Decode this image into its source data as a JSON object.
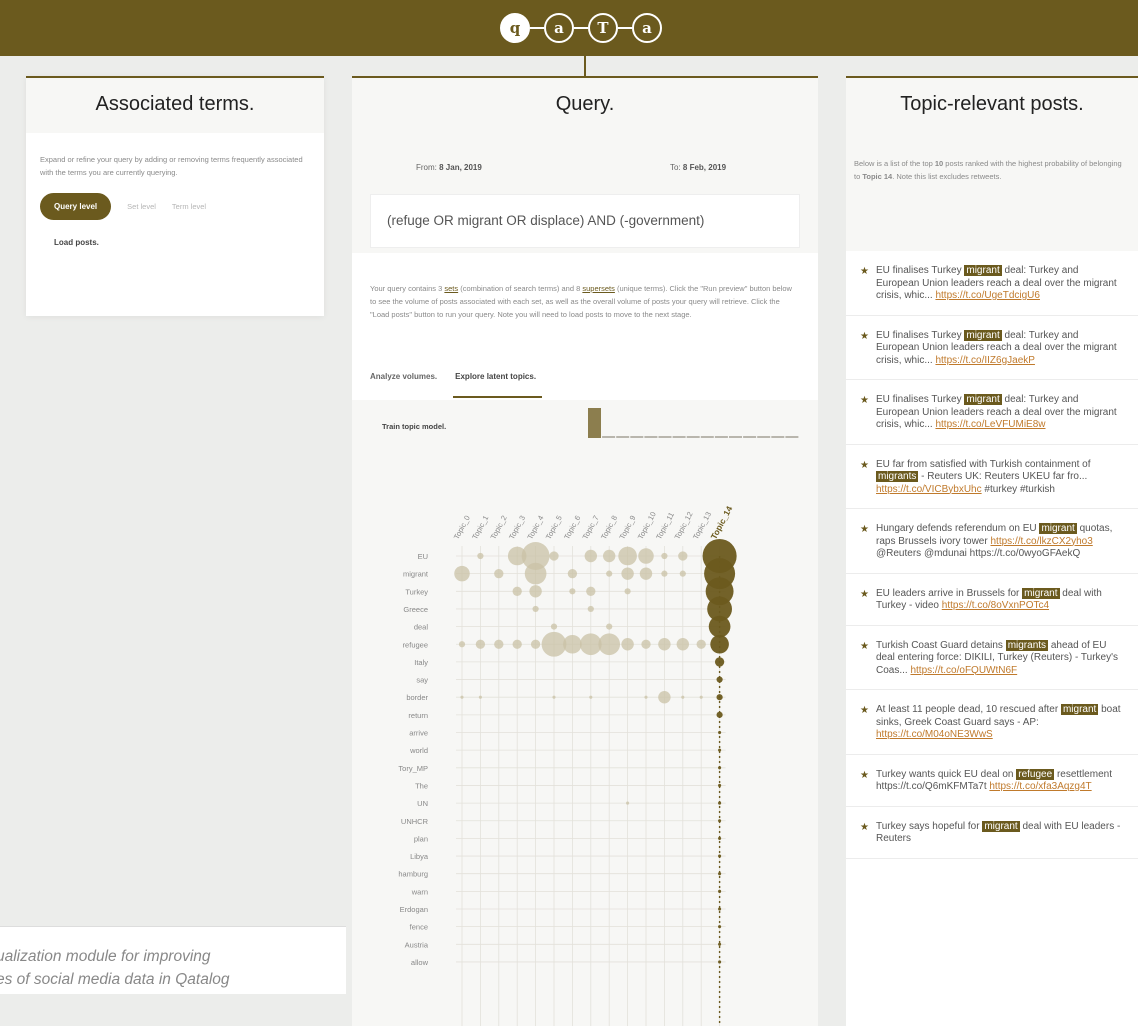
{
  "header": {
    "logo_letters": [
      "q",
      "a",
      "T",
      "a"
    ],
    "brand_color": "#6b5a1e"
  },
  "left_panel": {
    "title": "Associated terms.",
    "description": "Expand or refine your query by adding or removing terms frequently associated with the terms you are currently querying.",
    "mode_active": "Query level",
    "mode_set": "Set level",
    "mode_term": "Term level",
    "load_link": "Load posts."
  },
  "middle_panel": {
    "title": "Query.",
    "from_label": "From:",
    "from_value": "8 Jan, 2019",
    "to_label": "To:",
    "to_value": "8 Feb, 2019",
    "query": "(refuge OR migrant OR displace) AND (-government)",
    "note_a": "Your query contains ",
    "note_sets_count": "3",
    "note_sets_word": "sets",
    "note_b": " (combination of search terms) and ",
    "note_super_count": "8",
    "note_super_word": "supersets",
    "note_c": " (unique terms). Click the \"Run preview\" button below to see the volume of posts associated with each set, as well as the overall volume of posts your query will retrieve. Click the \"Load posts\" button to run your query. Note you will need to load posts to move to the next stage.",
    "tabs": [
      "Analyze volumes.",
      "Explore latent topics."
    ],
    "active_tab": 1,
    "train_label": "Train topic model."
  },
  "chart_data": {
    "type": "heatmap",
    "topics": [
      "Topic_0",
      "Topic_1",
      "Topic_2",
      "Topic_3",
      "Topic_4",
      "Topic_5",
      "Topic_6",
      "Topic_7",
      "Topic_8",
      "Topic_9",
      "Topic_10",
      "Topic_11",
      "Topic_12",
      "Topic_13",
      "Topic_14"
    ],
    "selected_topic": "Topic_14",
    "terms": [
      "EU",
      "migrant",
      "Turkey",
      "Greece",
      "deal",
      "refugee",
      "Italy",
      "say",
      "border",
      "return",
      "arrive",
      "world",
      "Tory_MP",
      "The",
      "UN",
      "UNHCR",
      "plan",
      "Libya",
      "hamburg",
      "warn",
      "Erdogan",
      "fence",
      "Austria",
      "allow"
    ],
    "histogram": [
      9,
      0.4,
      0.4,
      0.4,
      0.4,
      0.4,
      0.4,
      0.4,
      0.4,
      0.4,
      0.4,
      0.4,
      0.4,
      0.4,
      0.4
    ],
    "bubbles": [
      [
        0,
        1,
        2
      ],
      [
        0,
        3,
        6
      ],
      [
        0,
        4,
        9
      ],
      [
        0,
        5,
        3
      ],
      [
        0,
        7,
        4
      ],
      [
        0,
        8,
        4
      ],
      [
        0,
        9,
        6
      ],
      [
        0,
        10,
        5
      ],
      [
        0,
        11,
        2
      ],
      [
        0,
        12,
        3
      ],
      [
        0,
        14,
        11
      ],
      [
        1,
        0,
        5
      ],
      [
        1,
        2,
        3
      ],
      [
        1,
        4,
        7
      ],
      [
        1,
        6,
        3
      ],
      [
        1,
        8,
        2
      ],
      [
        1,
        9,
        4
      ],
      [
        1,
        10,
        4
      ],
      [
        1,
        11,
        2
      ],
      [
        1,
        12,
        2
      ],
      [
        1,
        14,
        10
      ],
      [
        2,
        3,
        3
      ],
      [
        2,
        4,
        4
      ],
      [
        2,
        6,
        2
      ],
      [
        2,
        7,
        3
      ],
      [
        2,
        9,
        2
      ],
      [
        2,
        14,
        9
      ],
      [
        3,
        4,
        2
      ],
      [
        3,
        7,
        2
      ],
      [
        3,
        14,
        8
      ],
      [
        4,
        5,
        2
      ],
      [
        4,
        8,
        2
      ],
      [
        4,
        14,
        7
      ],
      [
        5,
        0,
        2
      ],
      [
        5,
        1,
        3
      ],
      [
        5,
        2,
        3
      ],
      [
        5,
        3,
        3
      ],
      [
        5,
        4,
        3
      ],
      [
        5,
        5,
        8
      ],
      [
        5,
        6,
        6
      ],
      [
        5,
        7,
        7
      ],
      [
        5,
        8,
        7
      ],
      [
        5,
        9,
        4
      ],
      [
        5,
        10,
        3
      ],
      [
        5,
        11,
        4
      ],
      [
        5,
        12,
        4
      ],
      [
        5,
        13,
        3
      ],
      [
        5,
        14,
        6
      ],
      [
        6,
        14,
        3
      ],
      [
        7,
        14,
        2
      ],
      [
        8,
        0,
        1
      ],
      [
        8,
        1,
        1
      ],
      [
        8,
        5,
        1
      ],
      [
        8,
        7,
        1
      ],
      [
        8,
        10,
        1
      ],
      [
        8,
        11,
        4
      ],
      [
        8,
        12,
        1
      ],
      [
        8,
        13,
        1
      ],
      [
        8,
        14,
        2
      ],
      [
        9,
        14,
        2
      ],
      [
        10,
        14,
        1
      ],
      [
        11,
        14,
        1
      ],
      [
        12,
        14,
        1
      ],
      [
        13,
        14,
        1
      ],
      [
        14,
        9,
        1
      ],
      [
        14,
        14,
        1
      ],
      [
        15,
        14,
        1
      ],
      [
        16,
        14,
        1
      ],
      [
        17,
        14,
        1
      ],
      [
        18,
        14,
        1
      ],
      [
        19,
        14,
        1
      ],
      [
        20,
        14,
        1
      ],
      [
        21,
        14,
        1
      ],
      [
        22,
        14,
        1
      ],
      [
        23,
        14,
        1
      ]
    ],
    "bubble_color": "#c9c1a6",
    "selected_color": "#6b5a1e",
    "grid": true
  },
  "right_panel": {
    "title": "Topic-relevant posts.",
    "desc_a": "Below is a list of the top ",
    "desc_count": "10",
    "desc_b": " posts ranked with the highest probability of belonging to ",
    "desc_topic": "Topic 14",
    "desc_c": ". Note this list excludes retweets.",
    "posts": [
      {
        "before": "EU finalises Turkey ",
        "hl": "migrant",
        "after": " deal: Turkey and European Union leaders reach a deal over the migrant crisis, whic... ",
        "link": "https://t.co/UgeTdcigU6",
        "tail": ""
      },
      {
        "before": "EU finalises Turkey ",
        "hl": "migrant",
        "after": " deal: Turkey and European Union leaders reach a deal over the migrant crisis, whic... ",
        "link": "https://t.co/IIZ6gJaekP",
        "tail": ""
      },
      {
        "before": "EU finalises Turkey ",
        "hl": "migrant",
        "after": " deal: Turkey and European Union leaders reach a deal over the migrant crisis, whic... ",
        "link": "https://t.co/LeVFUMiE8w",
        "tail": ""
      },
      {
        "before": "EU far from satisfied with Turkish containment of ",
        "hl": "migrants",
        "after": " - Reuters UK: Reuters UKEU far fro... ",
        "link": "https://t.co/VICBybxUhc",
        "tail": " #turkey #turkish"
      },
      {
        "before": "Hungary defends referendum on EU ",
        "hl": "migrant",
        "after": " quotas, raps Brussels ivory tower ",
        "link": "https://t.co/lkzCX2yho3",
        "tail": " @Reuters @mdunai https://t.co/0wyoGFAekQ"
      },
      {
        "before": "EU leaders arrive in Brussels for ",
        "hl": "migrant",
        "after": " deal with Turkey - video ",
        "link": "https://t.co/8oVxnPOTc4",
        "tail": ""
      },
      {
        "before": "Turkish Coast Guard detains ",
        "hl": "migrants",
        "after": " ahead of EU deal entering force: DIKILI, Turkey (Reuters) - Turkey's Coas... ",
        "link": "https://t.co/oFQUWtN6F",
        "tail": ""
      },
      {
        "before": "At least 11 people dead, 10 rescued after ",
        "hl": "migrant",
        "after": " boat sinks, Greek Coast Guard says - AP: ",
        "link": "https://t.co/M04oNE3WwS",
        "tail": ""
      },
      {
        "before": "Turkey wants quick EU deal on ",
        "hl": "refugee",
        "after": " resettlement https://t.co/Q6mKFMTa7t ",
        "link": "https://t.co/xfa3Aqzg4T",
        "tail": ""
      },
      {
        "before": "Turkey says hopeful for ",
        "hl": "migrant",
        "after": " deal with EU leaders - Reuters",
        "link": "",
        "tail": ""
      }
    ]
  },
  "caption": {
    "line1": "ualization module for improving",
    "line2": "es of social media data in Qatalog"
  }
}
